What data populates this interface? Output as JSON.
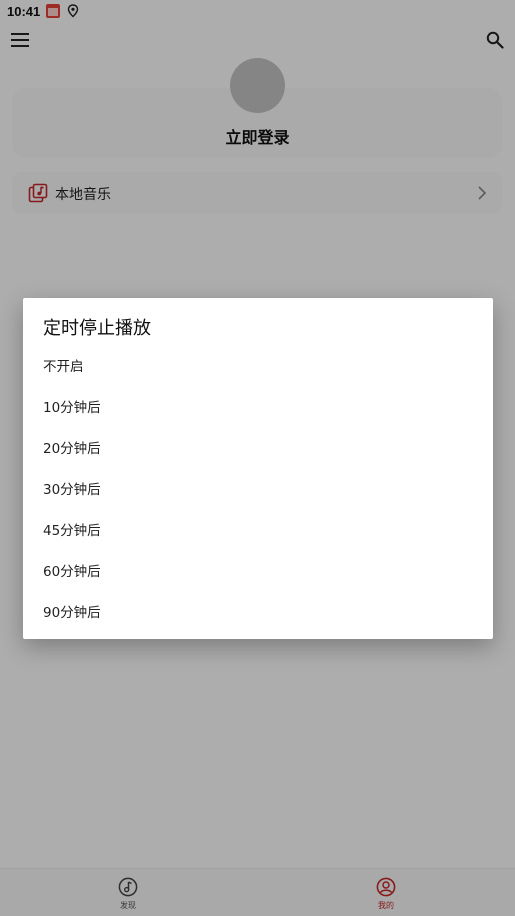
{
  "status_bar": {
    "time": "10:41"
  },
  "top_bar": {
    "menu_icon": "hamburger-menu-icon",
    "search_icon": "search-icon"
  },
  "profile": {
    "login_label": "立即登录"
  },
  "local_music": {
    "label": "本地音乐"
  },
  "bottom_nav": {
    "items": [
      {
        "label": "发现",
        "icon": "music-note-icon",
        "active": false
      },
      {
        "label": "我的",
        "icon": "user-circle-icon",
        "active": true
      }
    ]
  },
  "dialog": {
    "title": "定时停止播放",
    "options": [
      "不开启",
      "10分钟后",
      "20分钟后",
      "30分钟后",
      "45分钟后",
      "60分钟后",
      "90分钟后"
    ]
  },
  "colors": {
    "accent": "#c62828",
    "scrim": "rgba(0,0,0,0.32)"
  }
}
